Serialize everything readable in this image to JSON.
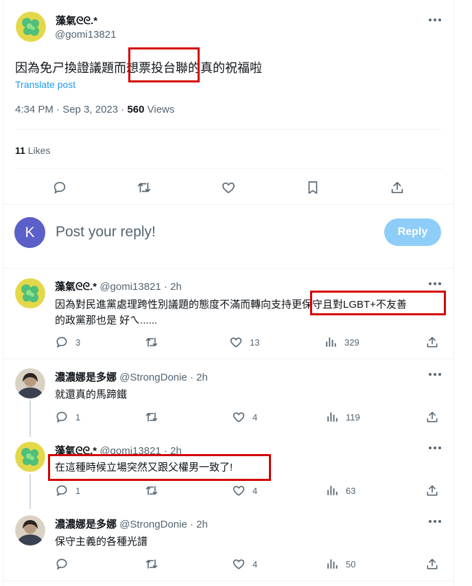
{
  "main_tweet": {
    "display_name": "藻氣ᘓᘓ.*",
    "handle": "@gomi13821",
    "text": "因為免ㄕ換證議題而想票投台聯的真的祝福啦",
    "translate_label": "Translate post",
    "timestamp": "4:34 PM · Sep 3, 2023 · ",
    "views_count": "560",
    "views_label": " Views",
    "likes_count": "11",
    "likes_label": " Likes"
  },
  "reply_box": {
    "avatar_letter": "K",
    "placeholder": "Post your reply!",
    "reply_button": "Reply",
    "avatar_color": "#5b5fc7",
    "button_color": "#8ecdf8"
  },
  "replies": [
    {
      "display_name": "藻氣ᘓᘓ.*",
      "handle": "@gomi13821",
      "sep": "·",
      "time": "2h",
      "text_line1": "因為對民進黨處理跨性別議題的態度不滿而轉向支持更保守且對LGBT+不友善",
      "text_line2": "的政黨那也是 好ㄟ......",
      "replies": "3",
      "retweets": "",
      "likes": "13",
      "views": "329"
    },
    {
      "display_name": "濃濃娜是多娜",
      "handle": "@StrongDonie",
      "sep": "·",
      "time": "2h",
      "text": "就還真的馬蹄鐵",
      "replies": "1",
      "retweets": "",
      "likes": "4",
      "views": "119"
    },
    {
      "display_name": "藻氣ᘓᘓ.*",
      "handle": "@gomi13821",
      "sep": "·",
      "time": "2h",
      "text": "在這種時候立場突然又跟父權男一致了!",
      "replies": "1",
      "retweets": "",
      "likes": "4",
      "views": "63"
    },
    {
      "display_name": "濃濃娜是多娜",
      "handle": "@StrongDonie",
      "sep": "·",
      "time": "2h",
      "text": "保守主義的各種光譜",
      "replies": "",
      "retweets": "",
      "likes": "4",
      "views": "50"
    }
  ],
  "colors": {
    "highlight_box": "#d40000",
    "link": "#1d9bf0",
    "muted_text": "#536471"
  }
}
